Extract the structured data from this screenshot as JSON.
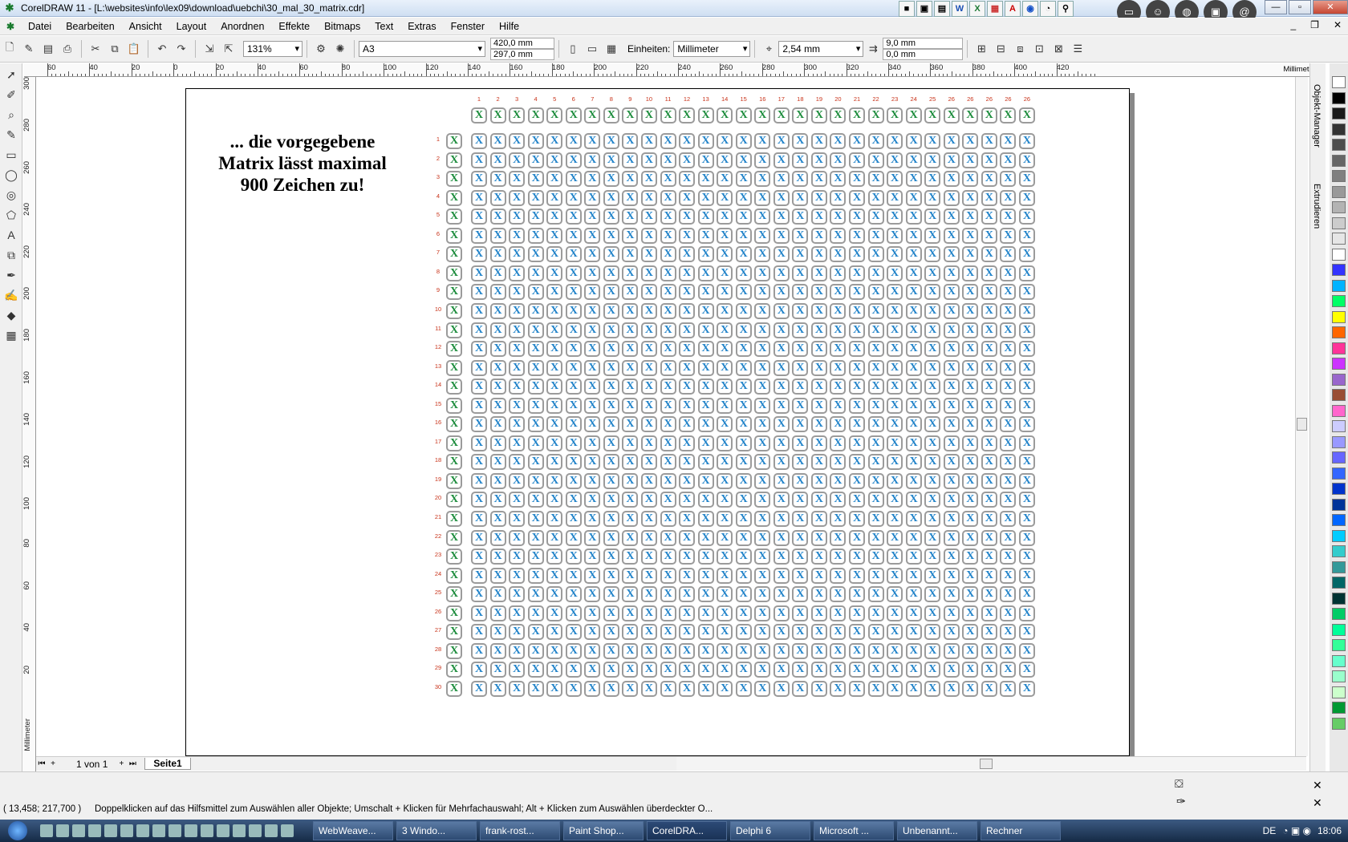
{
  "window": {
    "title": "CorelDRAW 11 - [L:\\websites\\info\\lex09\\download\\uebchi\\30_mal_30_matrix.cdr]"
  },
  "menu": [
    "Datei",
    "Bearbeiten",
    "Ansicht",
    "Layout",
    "Anordnen",
    "Effekte",
    "Bitmaps",
    "Text",
    "Extras",
    "Fenster",
    "Hilfe"
  ],
  "toolbar": {
    "zoom": "131%",
    "paper": "A3",
    "width": "420,0 mm",
    "height": "297,0 mm",
    "units_label": "Einheiten:",
    "units_value": "Millimeter",
    "nudge": "2,54 mm",
    "dup_x": "9,0 mm",
    "dup_y": "0,0 mm"
  },
  "ruler": {
    "unit": "Millimeter",
    "h_labels": [
      "60",
      "40",
      "20",
      "0",
      "20",
      "40",
      "60",
      "80",
      "100",
      "120",
      "140",
      "160",
      "180",
      "200",
      "220",
      "240",
      "260",
      "280",
      "300",
      "320",
      "340",
      "360",
      "380",
      "400",
      "420"
    ],
    "v_labels": [
      "300",
      "280",
      "260",
      "240",
      "220",
      "200",
      "180",
      "160",
      "140",
      "120",
      "100",
      "80",
      "60",
      "40",
      "20"
    ],
    "v_unit": "Millimeter"
  },
  "document": {
    "headline_lines": [
      "... die vorgegebene",
      "Matrix lässt maximal",
      "900 Zeichen zu!"
    ],
    "cell_char": "X",
    "column_numbers": [
      "1",
      "2",
      "3",
      "4",
      "5",
      "6",
      "7",
      "8",
      "9",
      "10",
      "11",
      "12",
      "13",
      "14",
      "15",
      "16",
      "17",
      "18",
      "19",
      "20",
      "21",
      "22",
      "23",
      "24",
      "25",
      "26",
      "26",
      "26",
      "26",
      "26"
    ],
    "row_numbers": [
      "1",
      "2",
      "3",
      "4",
      "5",
      "6",
      "7",
      "8",
      "9",
      "10",
      "11",
      "12",
      "13",
      "14",
      "15",
      "16",
      "17",
      "18",
      "19",
      "20",
      "21",
      "22",
      "23",
      "24",
      "25",
      "26",
      "27",
      "28",
      "29",
      "30"
    ],
    "green_color": "#1c8c3c",
    "blue_color": "#2183c9"
  },
  "dockers": [
    "Objekt-Manager",
    "Extrudieren"
  ],
  "palette": [
    "#ffffff",
    "#000000",
    "#1a1a1a",
    "#333333",
    "#4d4d4d",
    "#666666",
    "#808080",
    "#999999",
    "#b3b3b3",
    "#cccccc",
    "#e6e6e6",
    "#ffffff",
    "#3333ff",
    "#00b3ff",
    "#00ff66",
    "#ffff00",
    "#ff6600",
    "#ff3399",
    "#cc33ff",
    "#9966cc",
    "#994d33",
    "#ff66cc",
    "#ccccff",
    "#9999ff",
    "#6666ff",
    "#3366ff",
    "#0033cc",
    "#003399",
    "#0066ff",
    "#00ccff",
    "#33cccc",
    "#339999",
    "#006666",
    "#003333",
    "#00cc66",
    "#00ff99",
    "#33ff99",
    "#66ffcc",
    "#99ffcc",
    "#ccffcc",
    "#009933",
    "#66cc66"
  ],
  "pagenav": {
    "count": "1 von 1",
    "tab": "Seite1"
  },
  "status": {
    "coords": "( 13,458; 217,700 )",
    "hint": "Doppelklicken auf das Hilfsmittel zum Auswählen aller Objekte; Umschalt + Klicken für Mehrfachauswahl; Alt + Klicken zum Auswählen überdeckter O..."
  },
  "taskbar": {
    "tasks": [
      "WebWeave...",
      "3 Windo...",
      "frank-rost...",
      "Paint Shop...",
      "CorelDRA...",
      "Delphi 6",
      "Microsoft ...",
      "Unbenannt...",
      "Rechner"
    ],
    "lang": "DE",
    "clock": "18:06"
  }
}
